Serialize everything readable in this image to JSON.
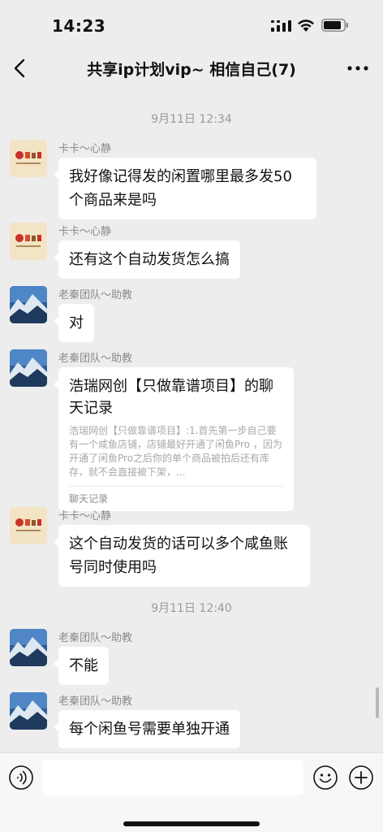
{
  "status_bar": {
    "time": "14:23"
  },
  "nav": {
    "title": "共享ip计划vip~ 相信自己(7)"
  },
  "messages": [
    {
      "type": "timestamp",
      "text": "9月11日 12:34"
    },
    {
      "type": "text",
      "sender": "卡卡～心静",
      "avatar": "xianyu-store-avatar",
      "text": "我好像记得发的闲置哪里最多发50个商品来是吗"
    },
    {
      "type": "text",
      "sender": "卡卡～心静",
      "avatar": "xianyu-store-avatar",
      "text": "还有这个自动发货怎么搞"
    },
    {
      "type": "text",
      "sender": "老秦团队～助教",
      "avatar": "mountain-landscape-avatar",
      "text": "对"
    },
    {
      "type": "chat-record",
      "sender": "老秦团队～助教",
      "avatar": "mountain-landscape-avatar",
      "title": "浩瑞网创【只做靠谱项目】的聊天记录",
      "preview": "浩瑞网创【只做靠谱项目】:1.首先第一步自己要有一个咸鱼店铺，店铺最好开通了闲鱼Pro ，因为开通了闲鱼Pro之后你的单个商品被拍后还有库存，就不会直接被下架，...",
      "footer": "聊天记录"
    },
    {
      "type": "text",
      "sender": "卡卡～心静",
      "avatar": "xianyu-store-avatar",
      "text": "这个自动发货的话可以多个咸鱼账号同时使用吗"
    },
    {
      "type": "timestamp",
      "text": "9月11日 12:40"
    },
    {
      "type": "text",
      "sender": "老秦团队～助教",
      "avatar": "mountain-landscape-avatar",
      "text": "不能"
    },
    {
      "type": "text",
      "sender": "老秦团队～助教",
      "avatar": "mountain-landscape-avatar",
      "text": "每个闲鱼号需要单独开通"
    }
  ],
  "input": {
    "placeholder": ""
  },
  "icons": {
    "back": "back-icon",
    "more": "more-icon",
    "voice": "voice-icon",
    "emoji": "emoji-icon",
    "add": "add-icon"
  },
  "colors": {
    "background": "#ededed",
    "bubble": "#ffffff",
    "timestamp": "#9a9a9a",
    "sender": "#8a8a8a"
  }
}
